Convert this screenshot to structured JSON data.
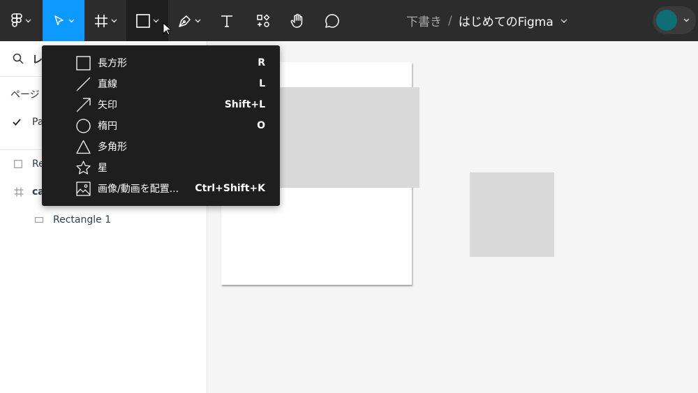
{
  "toolbar": {
    "breadcrumb": {
      "location": "下書き",
      "separator": "/",
      "file_name": "はじめてのFigma"
    }
  },
  "left_panel": {
    "search_label": "レ",
    "pages_label": "ページ",
    "current_page": "Pa",
    "layers": [
      {
        "name": "Re"
      },
      {
        "name": "ca"
      },
      {
        "name": "Rectangle 1"
      }
    ]
  },
  "shape_menu": {
    "items": [
      {
        "label": "長方形",
        "shortcut": "R",
        "icon": "rectangle-icon"
      },
      {
        "label": "直線",
        "shortcut": "L",
        "icon": "line-icon"
      },
      {
        "label": "矢印",
        "shortcut": "Shift+L",
        "icon": "arrow-icon"
      },
      {
        "label": "楕円",
        "shortcut": "O",
        "icon": "ellipse-icon"
      },
      {
        "label": "多角形",
        "shortcut": "",
        "icon": "polygon-icon"
      },
      {
        "label": "星",
        "shortcut": "",
        "icon": "star-icon"
      },
      {
        "label": "画像/動画を配置...",
        "shortcut": "Ctrl+Shift+K",
        "icon": "image-icon"
      }
    ]
  },
  "colors": {
    "toolbar_bg": "#2c2c2c",
    "accent_blue": "#0d99ff",
    "menu_bg": "#1e1e1e",
    "avatar": "#0e6e74",
    "placeholder_gray": "#d9d9d9"
  }
}
